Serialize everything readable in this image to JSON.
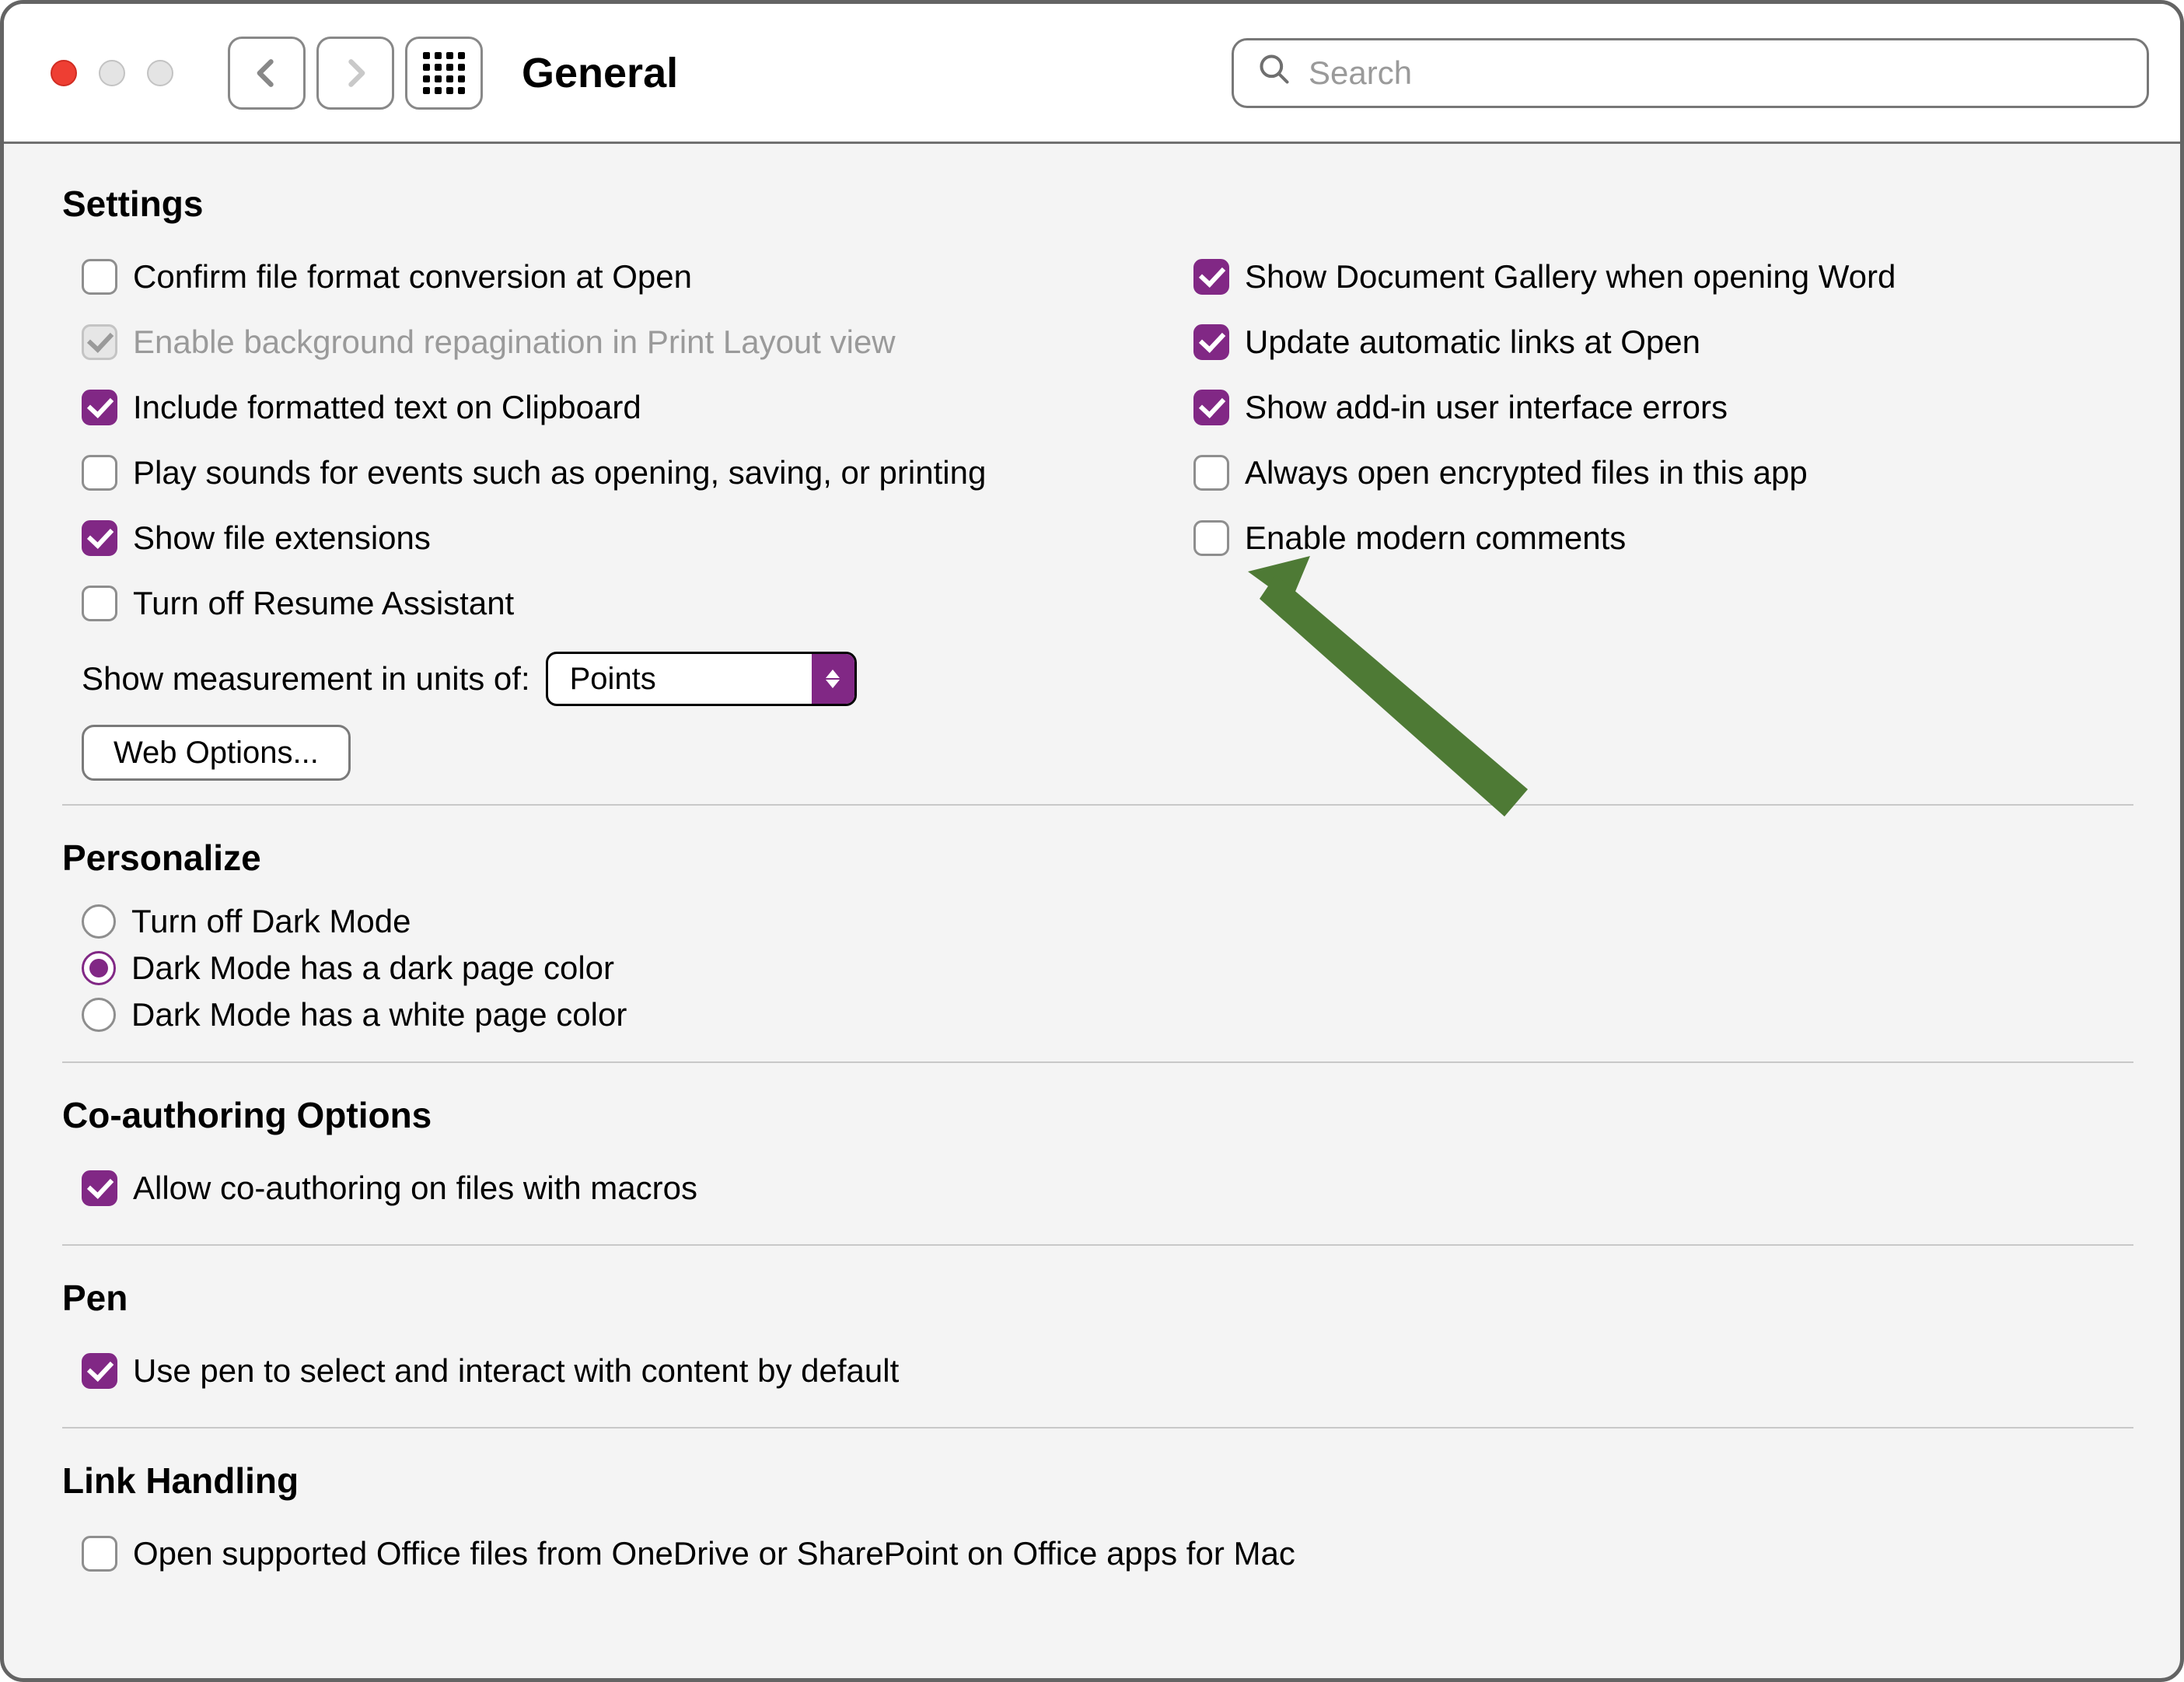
{
  "colors": {
    "accent": "#812885",
    "arrow": "#4e7a35"
  },
  "toolbar": {
    "title": "General",
    "search_placeholder": "Search"
  },
  "sections": {
    "settings": {
      "title": "Settings",
      "left": {
        "confirm_format": {
          "label": "Confirm file format conversion at Open",
          "checked": false
        },
        "enable_repagination": {
          "label": "Enable background repagination in Print Layout view",
          "checked": true,
          "disabled": true
        },
        "include_formatted": {
          "label": "Include formatted text on Clipboard",
          "checked": true
        },
        "play_sounds": {
          "label": "Play sounds for events such as opening, saving, or printing",
          "checked": false
        },
        "show_extensions": {
          "label": "Show file extensions",
          "checked": true
        },
        "turn_off_resume": {
          "label": "Turn off Resume Assistant",
          "checked": false
        }
      },
      "right": {
        "show_gallery": {
          "label": "Show Document Gallery when opening Word",
          "checked": true
        },
        "update_links": {
          "label": "Update automatic links at Open",
          "checked": true
        },
        "show_addin_errors": {
          "label": "Show add-in user interface errors",
          "checked": true
        },
        "always_open_encrypted": {
          "label": "Always open encrypted files in this app",
          "checked": false
        },
        "enable_modern_comments": {
          "label": "Enable modern comments",
          "checked": false
        }
      },
      "measurement": {
        "label": "Show measurement in units of:",
        "value": "Points"
      },
      "web_options_label": "Web Options..."
    },
    "personalize": {
      "title": "Personalize",
      "options": [
        {
          "label": "Turn off Dark Mode",
          "selected": false
        },
        {
          "label": "Dark Mode has a dark page color",
          "selected": true
        },
        {
          "label": "Dark Mode has a white page color",
          "selected": false
        }
      ]
    },
    "coauthoring": {
      "title": "Co-authoring Options",
      "allow_macros": {
        "label": "Allow co-authoring on files with macros",
        "checked": true
      }
    },
    "pen": {
      "title": "Pen",
      "use_pen": {
        "label": "Use pen to select and interact with content by default",
        "checked": true
      }
    },
    "link_handling": {
      "title": "Link Handling",
      "open_supported": {
        "label": "Open supported Office files from OneDrive or SharePoint on Office apps for Mac",
        "checked": false
      }
    }
  }
}
